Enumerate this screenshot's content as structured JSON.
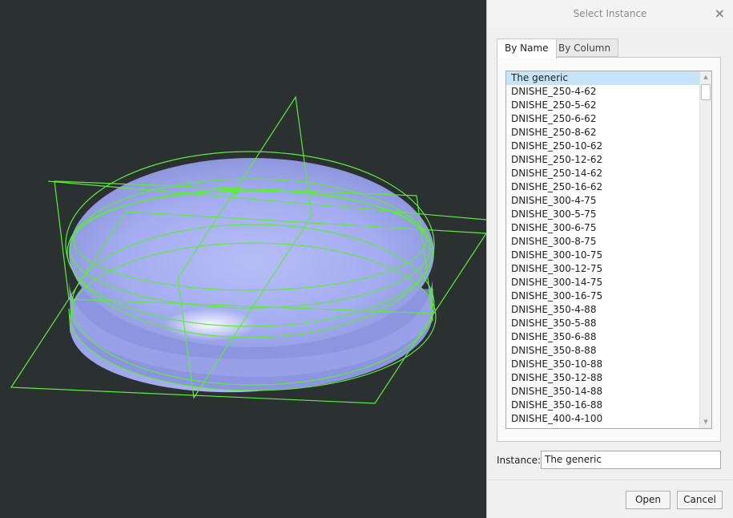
{
  "dialog": {
    "title": "Select Instance",
    "close_glyph": "×",
    "tabs": [
      {
        "label": "By Name",
        "active": true
      },
      {
        "label": "By Column",
        "active": false
      }
    ],
    "instances": [
      "The generic",
      "DNISHE_250-4-62",
      "DNISHE_250-5-62",
      "DNISHE_250-6-62",
      "DNISHE_250-8-62",
      "DNISHE_250-10-62",
      "DNISHE_250-12-62",
      "DNISHE_250-14-62",
      "DNISHE_250-16-62",
      "DNISHE_300-4-75",
      "DNISHE_300-5-75",
      "DNISHE_300-6-75",
      "DNISHE_300-8-75",
      "DNISHE_300-10-75",
      "DNISHE_300-12-75",
      "DNISHE_300-14-75",
      "DNISHE_300-16-75",
      "DNISHE_350-4-88",
      "DNISHE_350-5-88",
      "DNISHE_350-6-88",
      "DNISHE_350-8-88",
      "DNISHE_350-10-88",
      "DNISHE_350-12-88",
      "DNISHE_350-14-88",
      "DNISHE_350-16-88",
      "DNISHE_400-4-100"
    ],
    "selected_instance": "The generic",
    "instance_label": "Instance:",
    "instance_value": "The generic",
    "open_label": "Open",
    "cancel_label": "Cancel"
  },
  "icons": {
    "close": "close-icon",
    "scroll_up": "chevron-up-icon",
    "scroll_down": "chevron-down-icon"
  },
  "colors": {
    "viewport_background": "#2b3031",
    "model_fill": "#a3acf2",
    "wireframe": "#5eea3c",
    "selection": "#c6e4f7"
  }
}
